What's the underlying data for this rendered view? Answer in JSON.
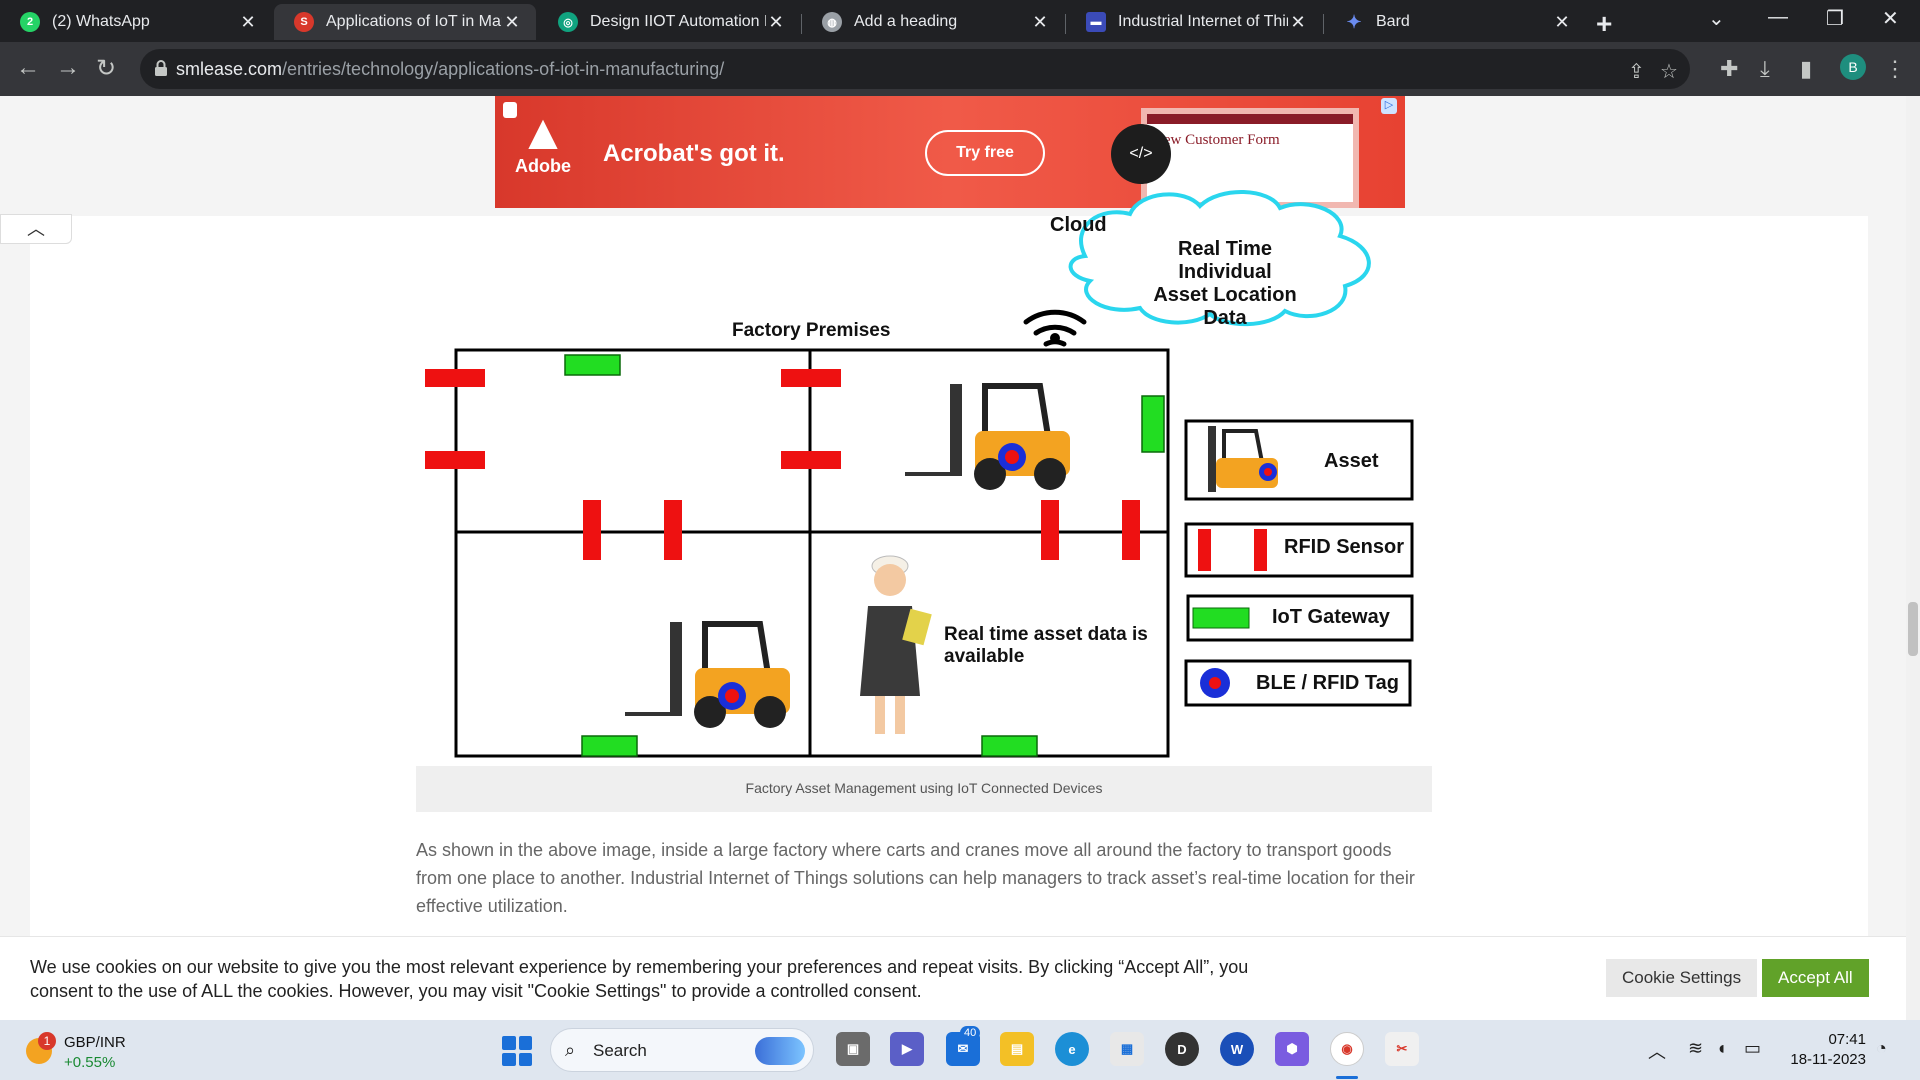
{
  "browser": {
    "tabs": [
      {
        "title": "(2) WhatsApp",
        "color": "#25d366"
      },
      {
        "title": "Applications of IoT in Manu",
        "color": "#d8382b"
      },
      {
        "title": "Design IIOT Automation Pc",
        "color": "#10a37f"
      },
      {
        "title": "Add a heading",
        "color": "#9aa0a6"
      },
      {
        "title": "Industrial Internet of Thing",
        "color": "#3b4bb8"
      },
      {
        "title": "Bard",
        "color": "#6b8cf0"
      }
    ],
    "url_host": "smlease.com",
    "url_path": "/entries/technology/applications-of-iot-in-manufacturing/",
    "profile_initial": "B"
  },
  "ad": {
    "brand": "Adobe",
    "headline": "Acrobat's got it.",
    "cta": "Try free",
    "form_title": "New Customer Form"
  },
  "diagram": {
    "cloud_label": "Cloud",
    "cloud_text_1": "Real Time Individual",
    "cloud_text_2": "Asset Location Data",
    "premises_label": "Factory Premises",
    "person_text_1": "Real time asset data is",
    "person_text_2": "available",
    "legend": {
      "asset": "Asset",
      "rfid": "RFID Sensor",
      "gateway": "IoT Gateway",
      "tag": "BLE / RFID Tag"
    }
  },
  "article": {
    "caption": "Factory Asset Management using IoT Connected Devices",
    "paragraph": "As shown in the above image, inside a large factory where carts and cranes move all around the factory to transport goods from one place to another. Industrial Internet of Things solutions can help managers to track asset’s real-time location for their effective utilization."
  },
  "cookies": {
    "text": "We use cookies on our website to give you the most relevant experience by remembering your preferences and repeat visits. By clicking “Accept All”, you consent to the use of ALL the cookies. However, you may visit \"Cookie Settings\" to provide a controlled consent.",
    "settings_label": "Cookie Settings",
    "accept_label": "Accept All"
  },
  "taskbar": {
    "ticker": "GBP/INR",
    "change": "+0.55%",
    "widget_badge": "1",
    "search_label": "Search",
    "mail_badge": "40",
    "time": "07:41",
    "date": "18-11-2023"
  },
  "colors": {
    "rfid_red": "#ee1111",
    "gateway_green": "#22dd22",
    "tag_blue": "#1a2fd8",
    "cloud_cyan": "#2ad6ee",
    "accept_green": "#61a229"
  }
}
